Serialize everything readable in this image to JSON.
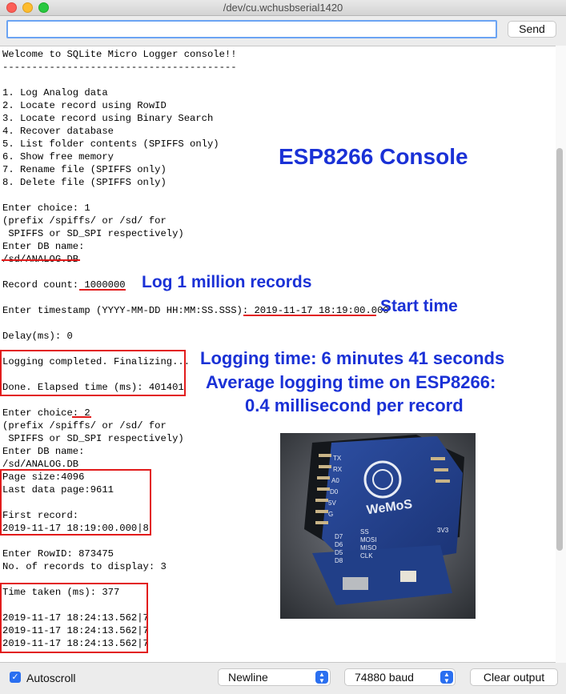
{
  "window": {
    "title": "/dev/cu.wchusbserial1420"
  },
  "toolbar": {
    "input_value": "",
    "send_label": "Send"
  },
  "console": {
    "lines": [
      "Welcome to SQLite Micro Logger console!!",
      "----------------------------------------",
      "",
      "1. Log Analog data",
      "2. Locate record using RowID",
      "3. Locate record using Binary Search",
      "4. Recover database",
      "5. List folder contents (SPIFFS only)",
      "6. Show free memory",
      "7. Rename file (SPIFFS only)",
      "8. Delete file (SPIFFS only)",
      "",
      "Enter choice: 1",
      "(prefix /spiffs/ or /sd/ for",
      " SPIFFS or SD_SPI respectively)",
      "Enter DB name:",
      "/sd/ANALOG.DB",
      "",
      "Record count: 1000000",
      "",
      "Enter timestamp (YYYY-MM-DD HH:MM:SS.SSS): 2019-11-17 18:19:00.000",
      "",
      "Delay(ms): 0",
      "",
      "Logging completed. Finalizing...",
      "",
      "Done. Elapsed time (ms): 401401",
      "",
      "Enter choice: 2",
      "(prefix /spiffs/ or /sd/ for",
      " SPIFFS or SD_SPI respectively)",
      "Enter DB name:",
      "/sd/ANALOG.DB",
      "Page size:4096",
      "Last data page:9611",
      "",
      "First record:",
      "2019-11-17 18:19:00.000|8",
      "",
      "Enter RowID: 873475",
      "No. of records to display: 3",
      "",
      "Time taken (ms): 377",
      "",
      "2019-11-17 18:24:13.562|7",
      "2019-11-17 18:24:13.562|7",
      "2019-11-17 18:24:13.562|7"
    ]
  },
  "annotations": {
    "console_title": "ESP8266 Console",
    "records": "Log 1 million records",
    "start_time": "Start time",
    "logging_time": "Logging time: 6 minutes 41 seconds",
    "average_line1": "Average logging time on ESP8266:",
    "average_line2": "0.4 millisecond per record",
    "color": "#1a31d6",
    "highlight_color": "#e21b1b"
  },
  "photo": {
    "brand_text": "WeMoS",
    "pins_left": [
      "TX",
      "RX",
      "A0",
      "D0",
      "D5",
      "D6",
      "D7",
      "D8",
      "3V3"
    ],
    "pins_right": [
      "5V",
      "G",
      "D4",
      "D3",
      "D2",
      "D1",
      "RST"
    ],
    "pins_bottom": [
      "D7",
      "D6",
      "D5",
      "D8"
    ],
    "pins_bottom2": [
      "SS",
      "MOSI",
      "MISO",
      "CLK"
    ],
    "label_3v3": "3V3"
  },
  "bottombar": {
    "autoscroll_label": "Autoscroll",
    "autoscroll_checked": true,
    "line_ending": "Newline",
    "baud": "74880 baud",
    "clear_label": "Clear output"
  }
}
